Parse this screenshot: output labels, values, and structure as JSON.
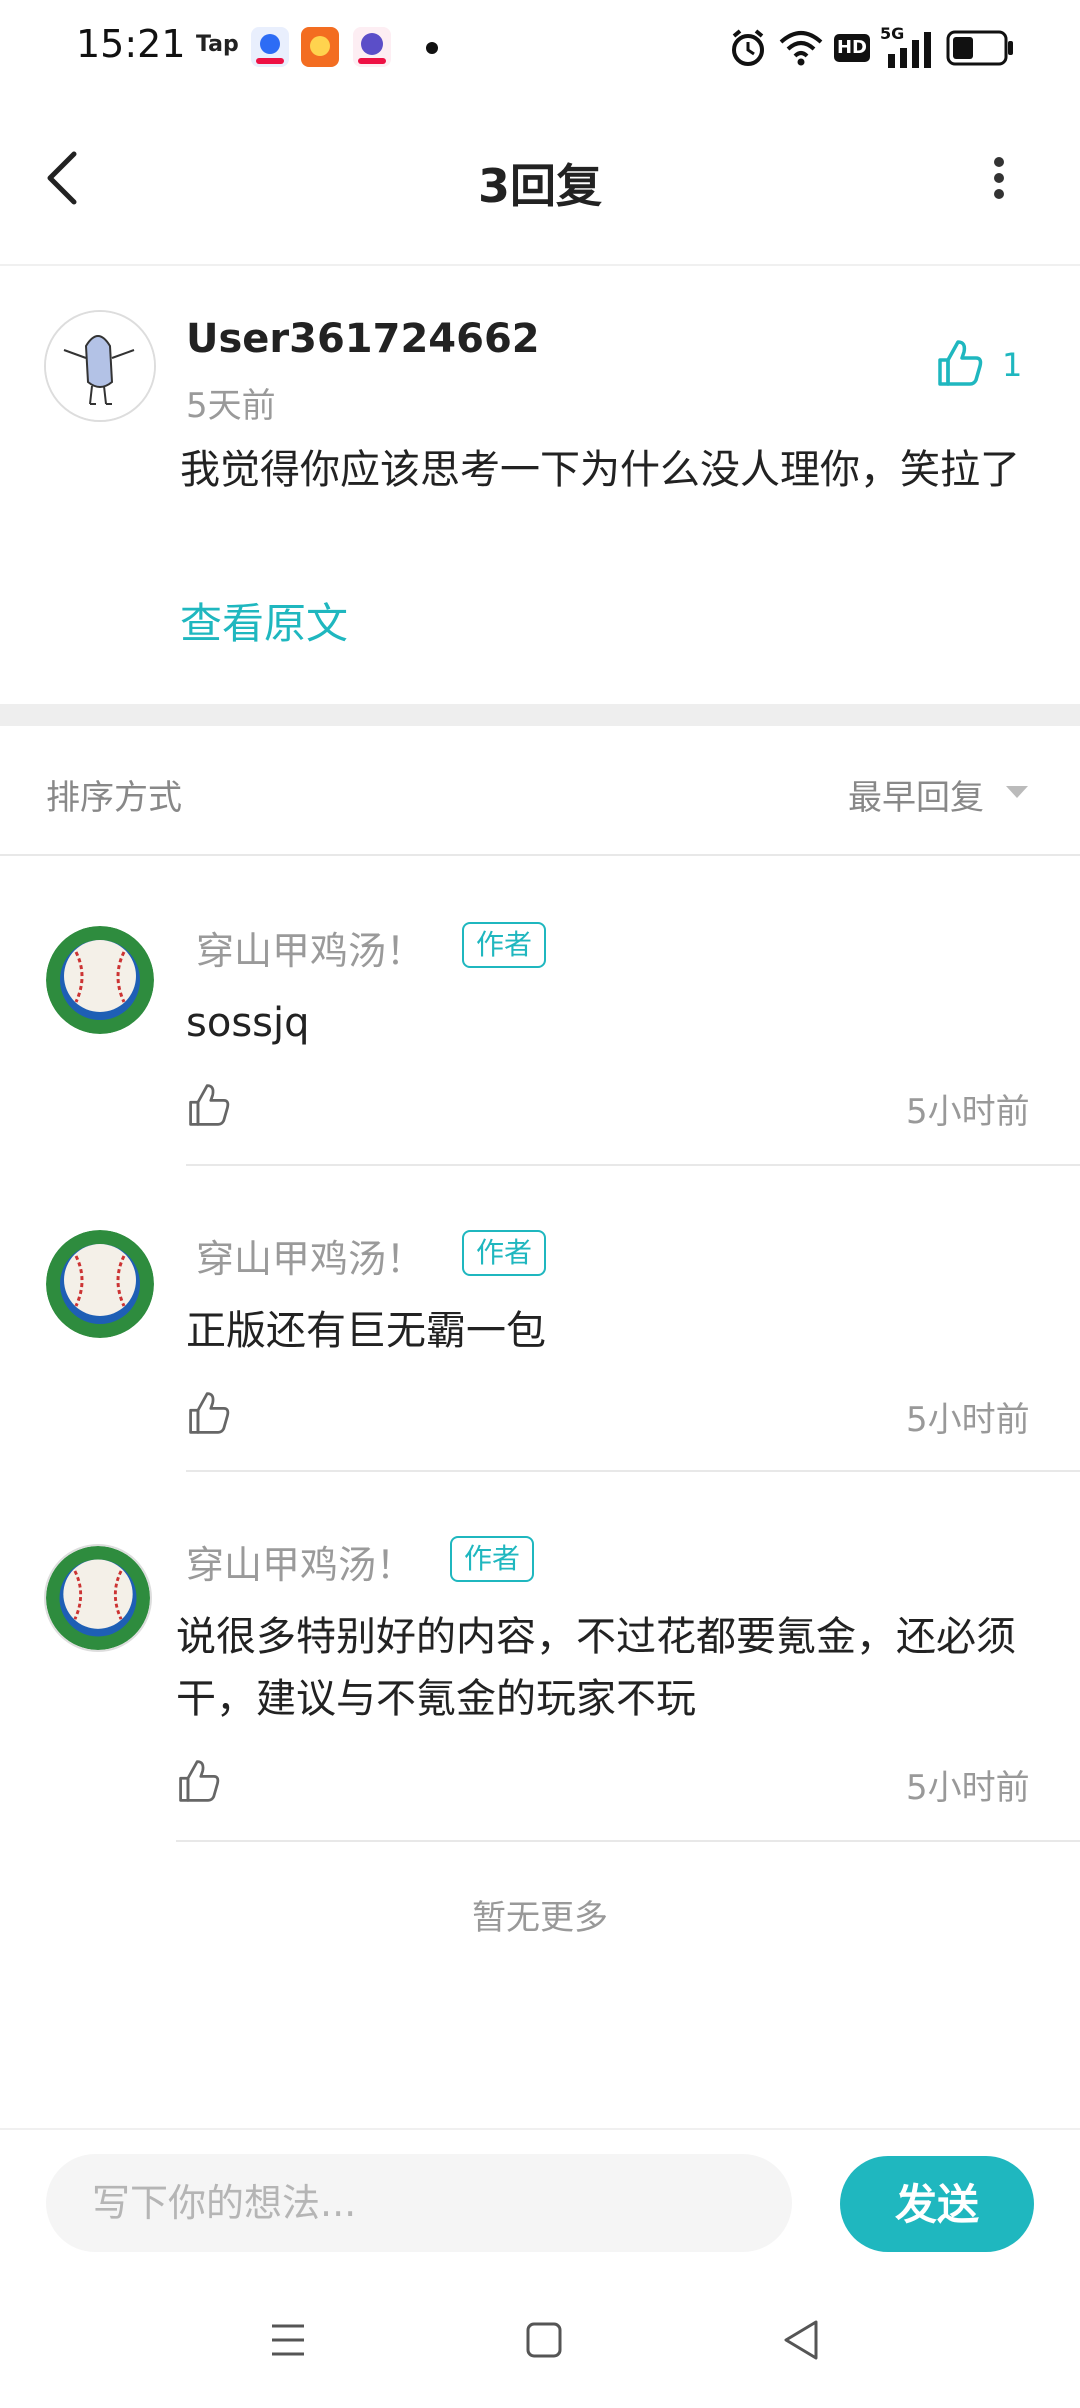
{
  "status_bar": {
    "time": "15:21",
    "app_icons": [
      "taptap-icon",
      "baidu-icon",
      "weibo-icon",
      "tieba-icon"
    ],
    "right_icons": [
      "alarm-icon",
      "wifi-icon",
      "hd-icon",
      "5g-signal-icon",
      "battery-icon"
    ],
    "hd_label": "HD",
    "network_label": "5G",
    "tap_label": "Tap"
  },
  "header": {
    "title": "3回复"
  },
  "main_comment": {
    "username": "User361724662",
    "time": "5天前",
    "text": "我觉得你应该思考一下为什么没人理你，笑拉了",
    "like_count": "1",
    "view_original": "查看原文"
  },
  "sort": {
    "label": "排序方式",
    "value": "最早回复"
  },
  "replies": [
    {
      "name": "穿山甲鸡汤！",
      "badge": "作者",
      "text": "sossjq",
      "time": "5小时前"
    },
    {
      "name": "穿山甲鸡汤！",
      "badge": "作者",
      "text": "正版还有巨无霸一包",
      "time": "5小时前"
    },
    {
      "name": "穿山甲鸡汤！",
      "badge": "作者",
      "text": "说很多特别好的内容，不过花都要氪金，还必须干，建议与不氪金的玩家不玩",
      "time": "5小时前"
    }
  ],
  "footer_note": "暂无更多",
  "input": {
    "placeholder": "写下你的想法...",
    "send_label": "发送"
  },
  "colors": {
    "accent": "#1fb7bf",
    "divider": "#eeeeee"
  }
}
